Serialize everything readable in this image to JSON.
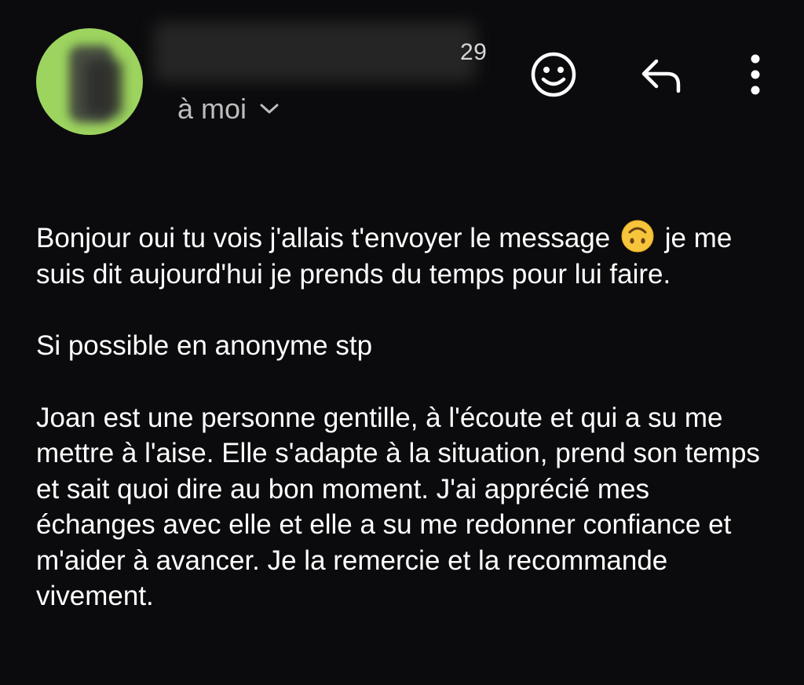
{
  "header": {
    "time_fragment": "29",
    "recipient_label": "à moi"
  },
  "icons": {
    "avatar": "avatar",
    "emoji_reaction": "emoji-reaction-icon",
    "reply": "reply-icon",
    "more": "more-vert-icon",
    "chevron": "chevron-down-icon",
    "upside_down_face": "upside-down-face-emoji"
  },
  "colors": {
    "background": "#0b0b0d",
    "avatar_bg": "#9dd45f",
    "text": "#ffffff",
    "secondary_text": "#bdbdbd"
  },
  "message": {
    "p1_before_emoji": "Bonjour oui tu vois j'allais t'envoyer le message",
    "p1_after_emoji": "je me suis dit aujourd'hui je prends du temps pour lui faire.",
    "p2": "Si possible en anonyme stp",
    "p3": "Joan est une personne gentille, à l'écoute et qui a su me mettre à l'aise. Elle s'adapte à la situation, prend son temps et sait quoi dire au bon moment. J'ai apprécié mes échanges avec elle et elle a su me redonner confiance et m'aider à avancer. Je la remercie et la recommande vivement."
  }
}
